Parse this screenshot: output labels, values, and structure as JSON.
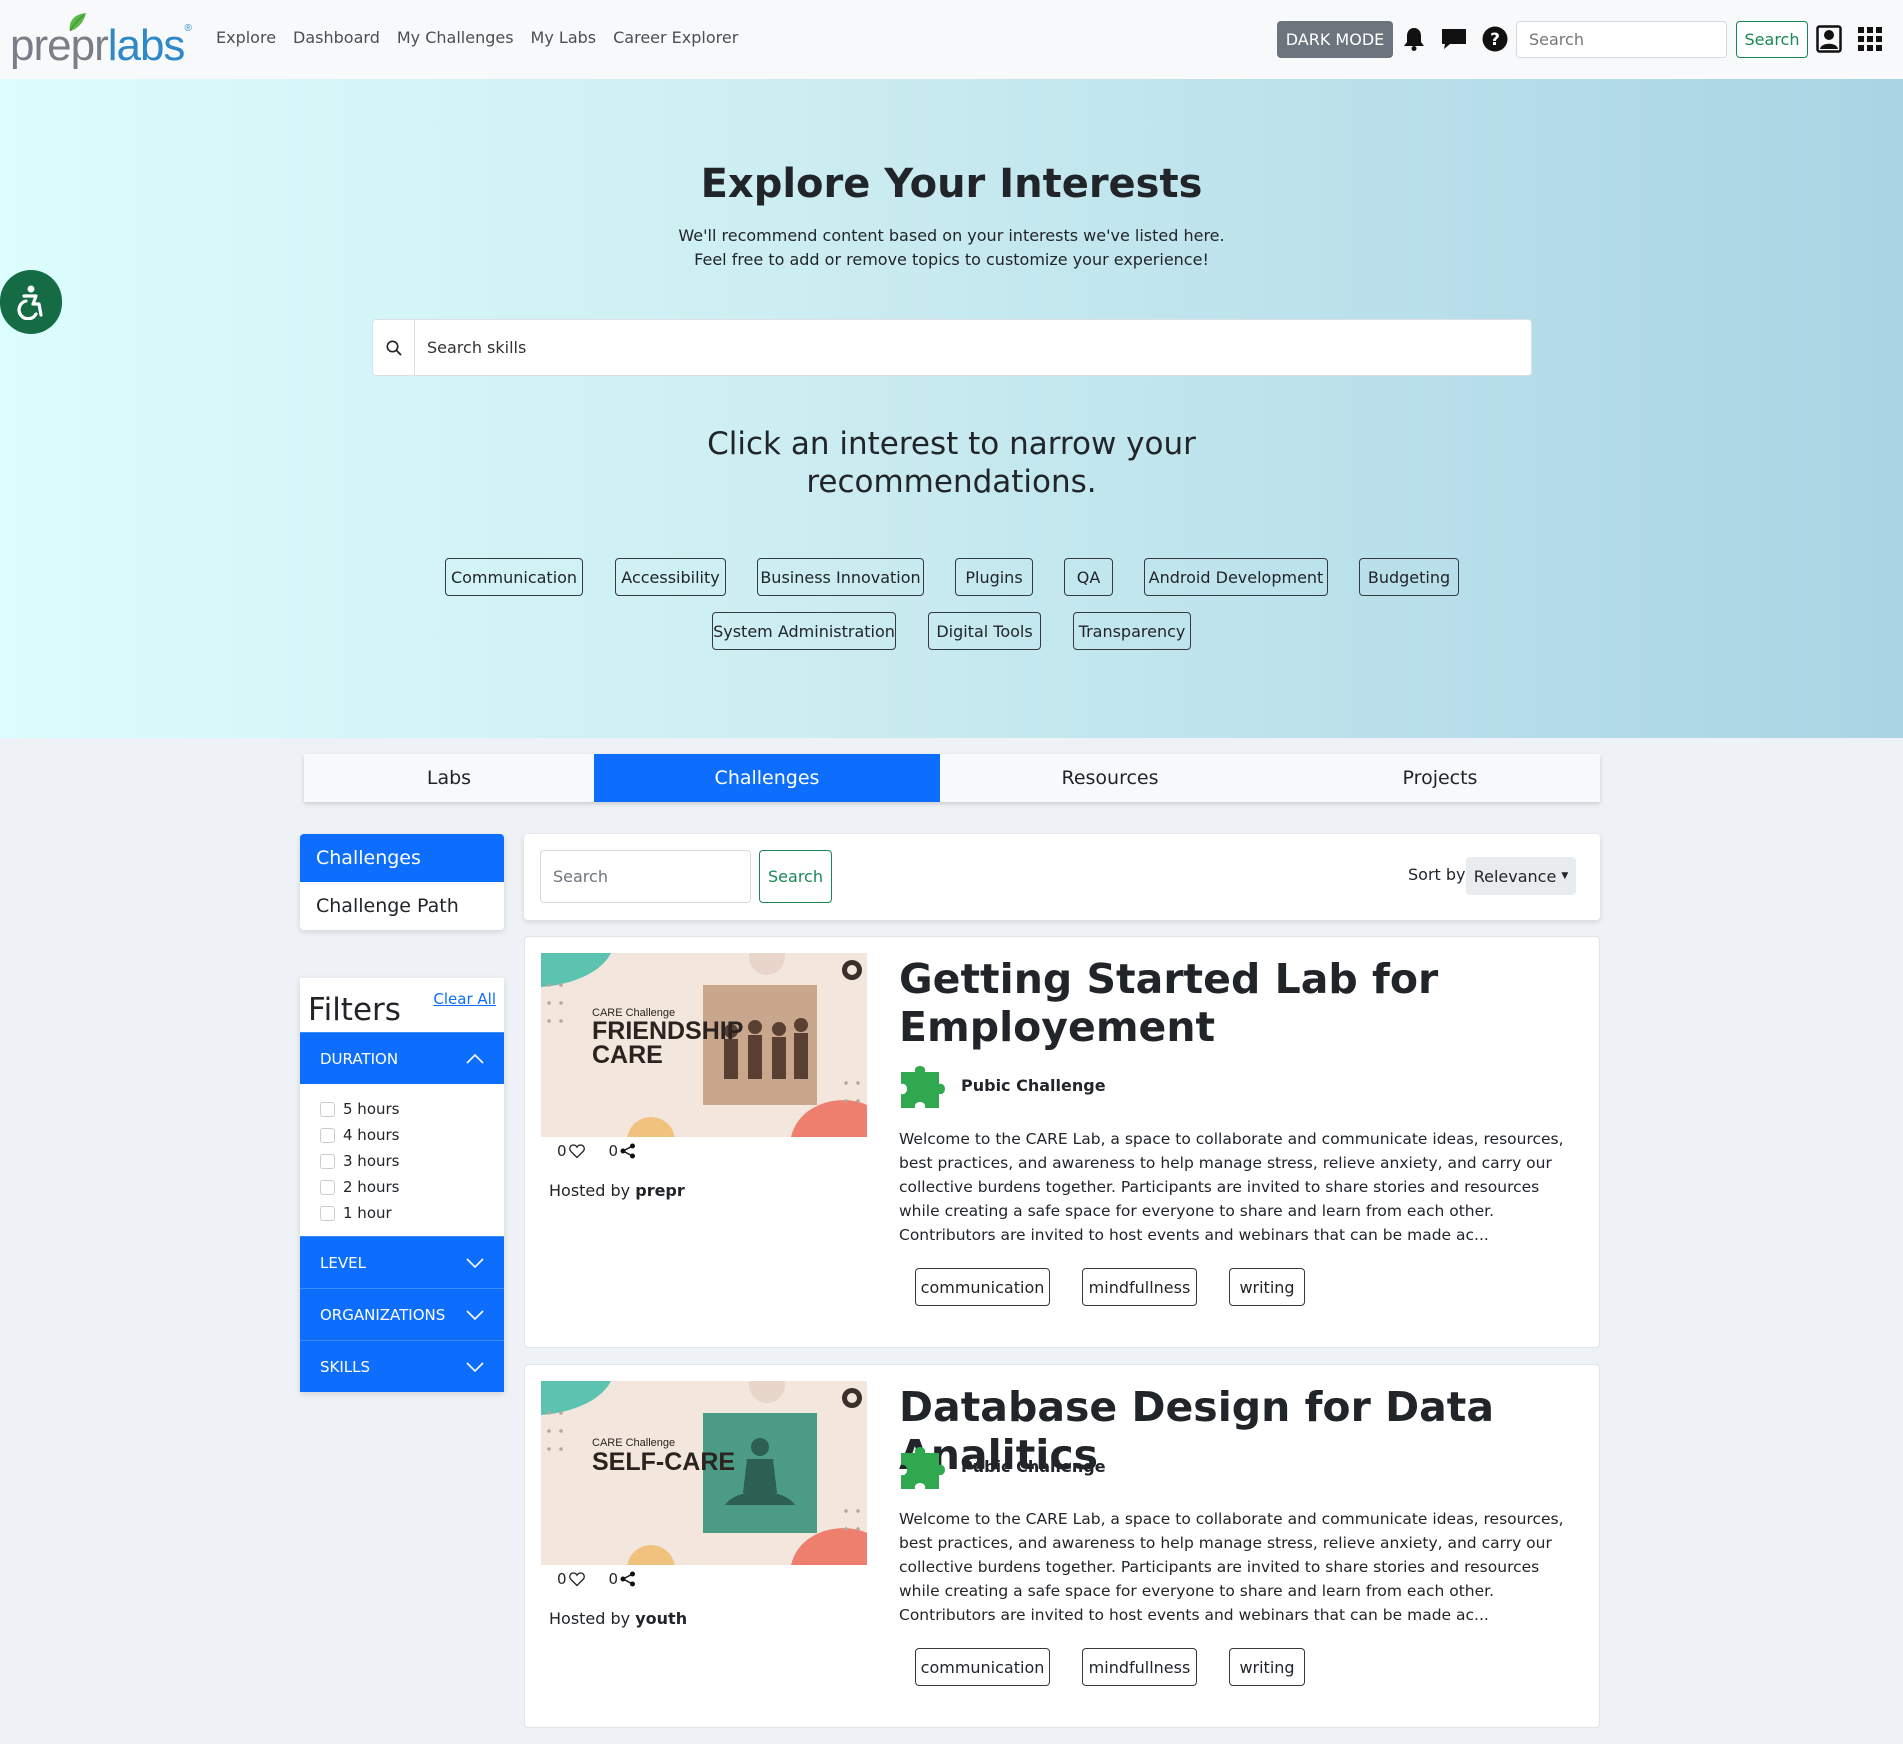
{
  "nav": {
    "logo_prefix": "prepr",
    "logo_suffix": "labs",
    "logo_reg": "®",
    "links": [
      "Explore",
      "Dashboard",
      "My Challenges",
      "My Labs",
      "Career Explorer"
    ],
    "dark_mode_label": "DARK MODE",
    "search_placeholder": "Search",
    "search_button": "Search",
    "icons": [
      "bell-icon",
      "chat-icon",
      "help-icon",
      "profile-icon",
      "apps-grid-icon"
    ]
  },
  "hero": {
    "title": "Explore Your Interests",
    "subtitle_line1": "We'll recommend content based on your interests we've listed here.",
    "subtitle_line2": "Feel free to add or remove topics to customize your experience!",
    "skill_search_placeholder": "Search skills",
    "click_title_line1": "Click an interest to narrow your",
    "click_title_line2": "recommendations.",
    "interests": [
      "Communication",
      "Accessibility",
      "Business Innovation",
      "Plugins",
      "QA",
      "Android Development",
      "Budgeting",
      "System Administration",
      "Digital Tools",
      "Transparency"
    ]
  },
  "tabs": {
    "items": [
      "Labs",
      "Challenges",
      "Resources",
      "Projects"
    ],
    "active": "Challenges"
  },
  "side_nav": {
    "items": [
      "Challenges",
      "Challenge Path"
    ],
    "active": "Challenges"
  },
  "filters": {
    "title": "Filters",
    "clear_all": "Clear All",
    "duration_label": "DURATION",
    "duration_options": [
      "5 hours",
      "4 hours",
      "3 hours",
      "2 hours",
      "1 hour"
    ],
    "level_label": "LEVEL",
    "organizations_label": "ORGANIZATIONS",
    "skills_label": "SKILLS"
  },
  "results_bar": {
    "search_placeholder": "Search",
    "search_button": "Search",
    "sort_label": "Sort by",
    "sort_value": "Relevance"
  },
  "cards": [
    {
      "title_line1": "Getting Started Lab for",
      "title_line2": "Employement",
      "badge": "Pubic Challenge",
      "thumb_kicker": "CARE Challenge",
      "thumb_line1": "FRIENDSHIP",
      "thumb_line2": "CARE",
      "likes": "0",
      "shares": "0",
      "hosted_prefix": "Hosted by",
      "host": "prepr",
      "description": "Welcome to the CARE Lab, a space to collaborate and communicate ideas, resources, best practices, and awareness to help manage stress, relieve anxiety, and carry our collective burdens together. Participants are invited to share stories and resources while creating a safe space for everyone to share and learn from each other. Contributors are invited to host events and webinars that can be made ac...",
      "tags": [
        "communication",
        "mindfullness",
        "writing"
      ]
    },
    {
      "title_line1": "Database Design for Data Analitics",
      "title_line2": "",
      "badge": "Pubic Challenge",
      "thumb_kicker": "CARE Challenge",
      "thumb_line1": "SELF-CARE",
      "thumb_line2": "",
      "likes": "0",
      "shares": "0",
      "hosted_prefix": "Hosted by",
      "host": "youth",
      "description": "Welcome to the CARE Lab, a space to collaborate and communicate ideas, resources, best practices, and awareness to help manage stress, relieve anxiety, and carry our collective burdens together. Participants are invited to share stories and resources while creating a safe space for everyone to share and learn from each other. Contributors are invited to host events and webinars that can be made ac...",
      "tags": [
        "communication",
        "mindfullness",
        "writing"
      ]
    }
  ],
  "colors": {
    "primary": "#0d6efd",
    "success": "#198754",
    "accessibility_button": "#146b44",
    "puzzle_icon": "#2fa84f"
  }
}
